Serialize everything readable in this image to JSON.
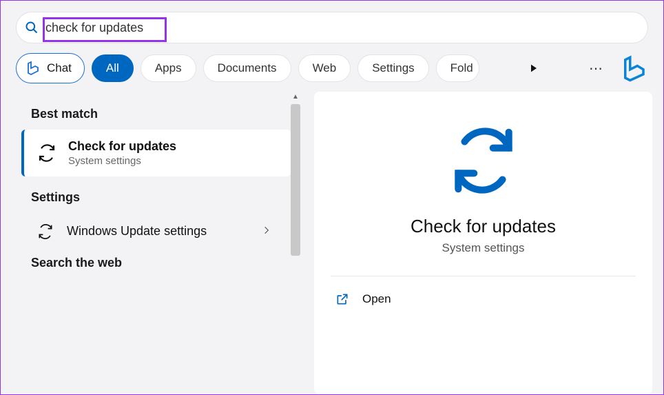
{
  "search": {
    "value": "check for updates"
  },
  "tabs": {
    "chat": "Chat",
    "all": "All",
    "apps": "Apps",
    "documents": "Documents",
    "web": "Web",
    "settings": "Settings",
    "folders": "Fold"
  },
  "sections": {
    "best_match": "Best match",
    "settings": "Settings",
    "search_web": "Search the web"
  },
  "best_match_result": {
    "title": "Check for updates",
    "subtitle": "System settings"
  },
  "settings_results": {
    "item1": "Windows Update settings"
  },
  "preview": {
    "title": "Check for updates",
    "subtitle": "System settings",
    "action_open": "Open"
  },
  "colors": {
    "accent_blue": "#0067c0",
    "highlight_purple": "#9333ea"
  }
}
